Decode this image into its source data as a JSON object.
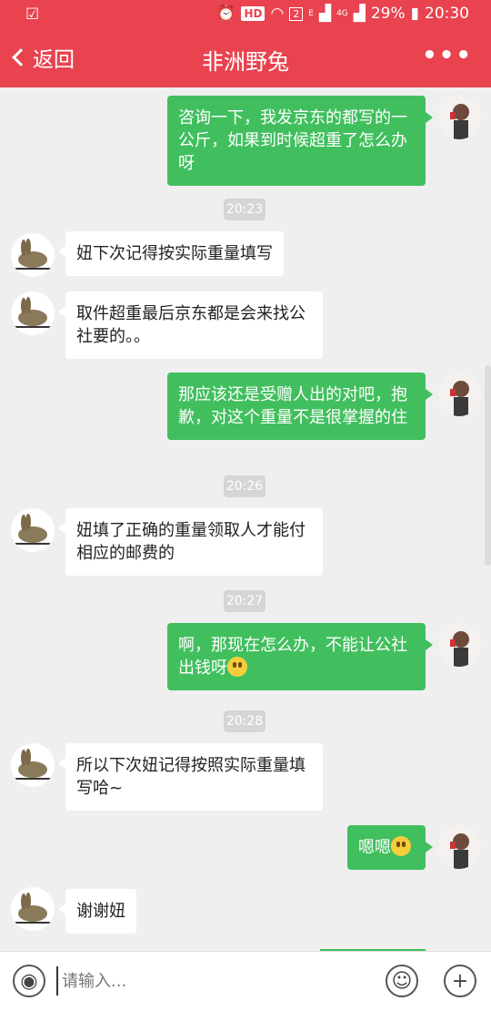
{
  "status_bar": {
    "hd": "HD",
    "sim": "2",
    "net_e": "E",
    "net_4g": "4G",
    "battery": "29%",
    "time": "20:30"
  },
  "header": {
    "back_label": "返回",
    "title": "非洲野兔",
    "more_label": "•••"
  },
  "messages": [
    {
      "type": "out",
      "text": "咨询一下，我发京东的都写的一公斤，如果到时候超重了怎么办呀"
    },
    {
      "type": "time",
      "text": "20:23"
    },
    {
      "type": "in",
      "text": "妞下次记得按实际重量填写"
    },
    {
      "type": "in",
      "text": "取件超重最后京东都是会来找公社要的。。"
    },
    {
      "type": "out",
      "text": "那应该还是受赠人出的对吧，抱歉，对这个重量不是很掌握的住"
    },
    {
      "type": "time",
      "text": "20:26"
    },
    {
      "type": "in",
      "text": "妞填了正确的重量领取人才能付相应的邮费的"
    },
    {
      "type": "time",
      "text": "20:27"
    },
    {
      "type": "out",
      "text": "啊，那现在怎么办，不能让公社出钱呀",
      "emoji": "sad-emoji"
    },
    {
      "type": "time",
      "text": "20:28"
    },
    {
      "type": "in",
      "text": "所以下次妞记得按照实际重量填写哈~"
    },
    {
      "type": "out",
      "text": "嗯嗯",
      "emoji": "sad-emoji"
    },
    {
      "type": "in",
      "text": "谢谢妞"
    }
  ],
  "input": {
    "placeholder": "请输入..."
  },
  "colors": {
    "header": "#e8434f",
    "outgoing_bubble": "#41bf5e",
    "incoming_bubble": "#ffffff",
    "background": "#efefef"
  }
}
